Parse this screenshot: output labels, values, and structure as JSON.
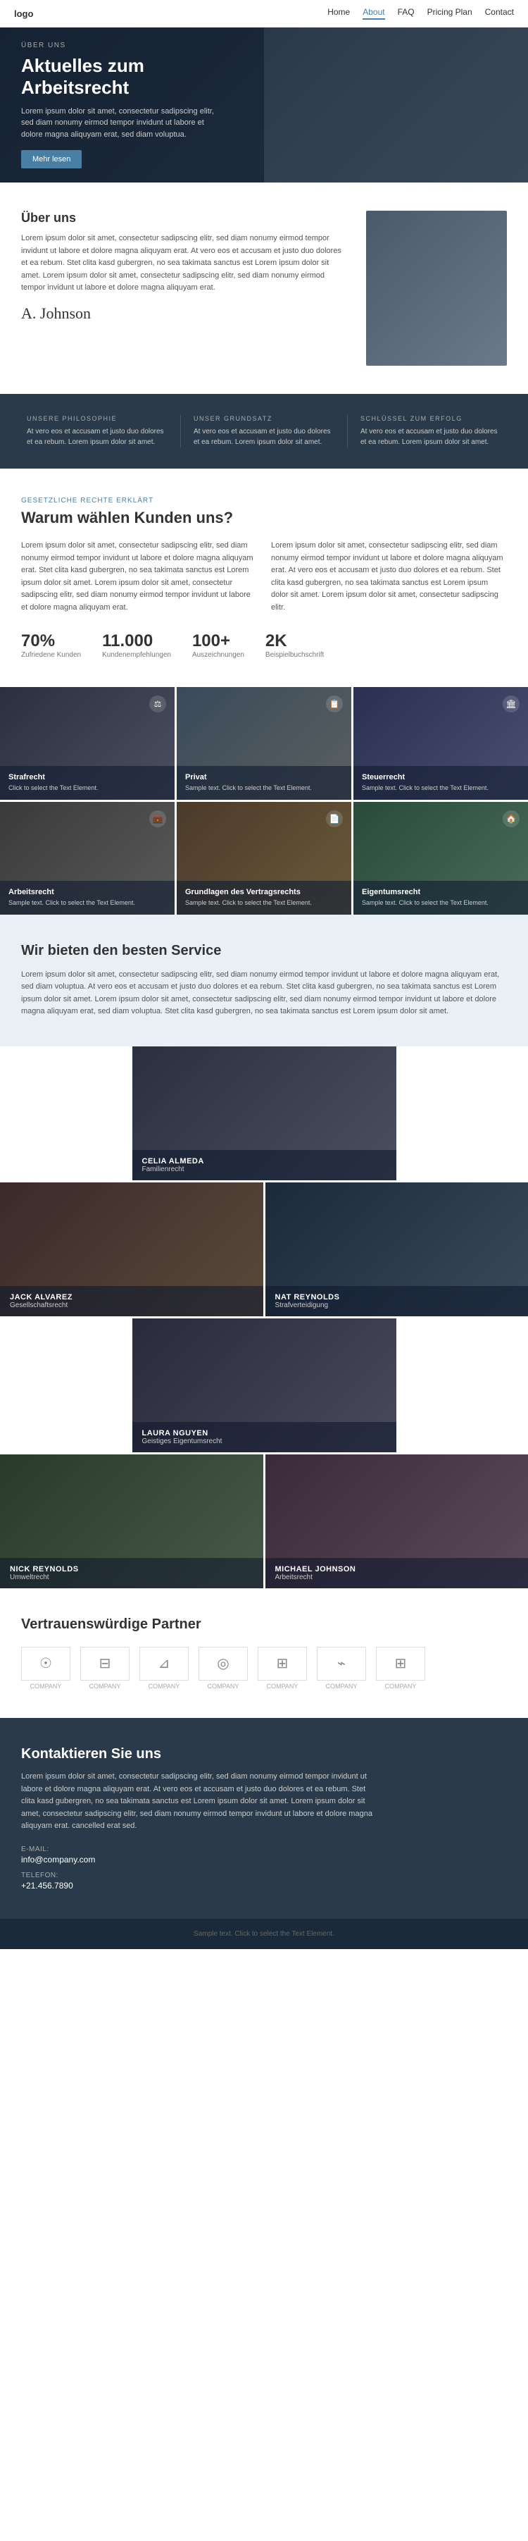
{
  "nav": {
    "logo": "logo",
    "links": [
      "Home",
      "About",
      "FAQ",
      "Pricing Plan",
      "Contact"
    ],
    "active": "About"
  },
  "hero": {
    "tag": "ÜBER UNS",
    "title": "Aktuelles zum Arbeitsrecht",
    "description": "Lorem ipsum dolor sit amet, consectetur sadipscing elitr, sed diam nonumy eirmod tempor invidunt ut labore et dolore magna aliquyam erat, sed diam voluptua.",
    "btn_label": "Mehr lesen"
  },
  "about": {
    "title": "Über uns",
    "text1": "Lorem ipsum dolor sit amet, consectetur sadipscing elitr, sed diam nonumy eirmod tempor invidunt ut labore et dolore magna aliquyam erat. At vero eos et accusam et justo duo dolores et ea rebum. Stet clita kasd gubergren, no sea takimata sanctus est Lorem ipsum dolor sit amet. Lorem ipsum dolor sit amet, consectetur sadipscing elitr, sed diam nonumy eirmod tempor invidunt ut labore et dolore magna aliquyam erat.",
    "signature": "A. Johnson"
  },
  "philosophy": {
    "items": [
      {
        "tag": "UNSERE PHILOSOPHIE",
        "text": "At vero eos et accusam et justo duo dolores et ea rebum. Lorem ipsum dolor sit amet."
      },
      {
        "tag": "UNSER GRUNDSATZ",
        "text": "At vero eos et accusam et justo duo dolores et ea rebum. Lorem ipsum dolor sit amet."
      },
      {
        "tag": "SCHLÜSSEL ZUM ERFOLG",
        "text": "At vero eos et accusam et justo duo dolores et ea rebum. Lorem ipsum dolor sit amet."
      }
    ]
  },
  "why": {
    "tag": "GESETZLICHE RECHTE ERKLÄRT",
    "title": "Warum wählen Kunden uns?",
    "col1": "Lorem ipsum dolor sit amet, consectetur sadipscing elitr, sed diam nonumy eirmod tempor invidunt ut labore et dolore magna aliquyam erat. Stet clita kasd gubergren, no sea takimata sanctus est Lorem ipsum dolor sit amet. Lorem ipsum dolor sit amet, consectetur sadipscing elitr, sed diam nonumy eirmod tempor invidunt ut labore et dolore magna aliquyam erat.",
    "col2": "Lorem ipsum dolor sit amet, consectetur sadipscing elitr, sed diam nonumy eirmod tempor invidunt ut labore et dolore magna aliquyam erat. At vero eos et accusam et justo duo dolores et ea rebum. Stet clita kasd gubergren, no sea takimata sanctus est Lorem ipsum dolor sit amet. Lorem ipsum dolor sit amet, consectetur sadipscing elitr.",
    "stats": [
      {
        "num": "70%",
        "label": "Zufriedene Kunden"
      },
      {
        "num": "11.000",
        "label": "Kundenempfehlungen"
      },
      {
        "num": "100+",
        "label": "Auszeichnungen"
      },
      {
        "num": "2K",
        "label": "Beispielbuchschrift"
      }
    ]
  },
  "services": {
    "items": [
      {
        "title": "Strafrecht",
        "desc": "Click to select the Text Element.",
        "icon": "⚖"
      },
      {
        "title": "Privat",
        "desc": "Sample text. Click to select the Text Element.",
        "icon": "📋"
      },
      {
        "title": "Steuerrecht",
        "desc": "Sample text. Click to select the Text Element.",
        "icon": "🏛"
      },
      {
        "title": "Arbeitsrecht",
        "desc": "Sample text. Click to select the Text Element.",
        "icon": "💼"
      },
      {
        "title": "Grundlagen des Vertragsrechts",
        "desc": "Sample text. Click to select the Text Element.",
        "icon": "📄"
      },
      {
        "title": "Eigentumsrecht",
        "desc": "Sample text. Click to select the Text Element.",
        "icon": "🏠"
      }
    ]
  },
  "best_service": {
    "title": "Wir bieten den besten Service",
    "text": "Lorem ipsum dolor sit amet, consectetur sadipscing elitr, sed diam nonumy eirmod tempor invidunt ut labore et dolore magna aliquyam erat, sed diam voluptua. At vero eos et accusam et justo duo dolores et ea rebum. Stet clita kasd gubergren, no sea takimata sanctus est Lorem ipsum dolor sit amet. Lorem ipsum dolor sit amet, consectetur sadipscing elitr, sed diam nonumy eirmod tempor invidunt ut labore et dolore magna aliquyam erat, sed diam voluptua. Stet clita kasd gubergren, no sea takimata sanctus est Lorem ipsum dolor sit amet."
  },
  "team": {
    "members": [
      {
        "name": "CELIA ALMEDA",
        "role": "Familienrecht",
        "position": "center"
      },
      {
        "name": "JACK ALVAREZ",
        "role": "Gesellschaftsrecht",
        "position": "left"
      },
      {
        "name": "NAT REYNOLDS",
        "role": "Strafverteidigung",
        "position": "right"
      },
      {
        "name": "LAURA NGUYEN",
        "role": "Geistiges Eigentumsrecht",
        "position": "center"
      },
      {
        "name": "NICK REYNOLDS",
        "role": "Umweltrecht",
        "position": "left"
      },
      {
        "name": "MICHAEL JOHNSON",
        "role": "Arbeitsrecht",
        "position": "right"
      }
    ]
  },
  "partners": {
    "title": "Vertrauenswürdige Partner",
    "logos": [
      {
        "symbol": "☉",
        "label": "COMPANY"
      },
      {
        "symbol": "⊟",
        "label": "COMPANY"
      },
      {
        "symbol": "⊿",
        "label": "COMPANY"
      },
      {
        "symbol": "◎",
        "label": "COMPANY"
      },
      {
        "symbol": "⊞",
        "label": "COMPANY"
      },
      {
        "symbol": "⌁",
        "label": "COMPANY"
      },
      {
        "symbol": "⊞",
        "label": "COMPANY"
      }
    ]
  },
  "contact": {
    "title": "Kontaktieren Sie uns",
    "text": "Lorem ipsum dolor sit amet, consectetur sadipscing elitr, sed diam nonumy eirmod tempor invidunt ut labore et dolore magna aliquyam erat. At vero eos et accusam et justo duo dolores et ea rebum. Stet clita kasd gubergren, no sea takimata sanctus est Lorem ipsum dolor sit amet. Lorem ipsum dolor sit amet, consectetur sadipscing elitr, sed diam nonumy eirmod tempor invidunt ut labore et dolore magna aliquyam erat. cancelled erat sed.",
    "email_label": "E-Mail:",
    "email_value": "info@company.com",
    "phone_label": "Telefon:",
    "phone_value": "+21.456.7890"
  },
  "footer": {
    "text": "Sample text. Click to select the Text Element."
  }
}
